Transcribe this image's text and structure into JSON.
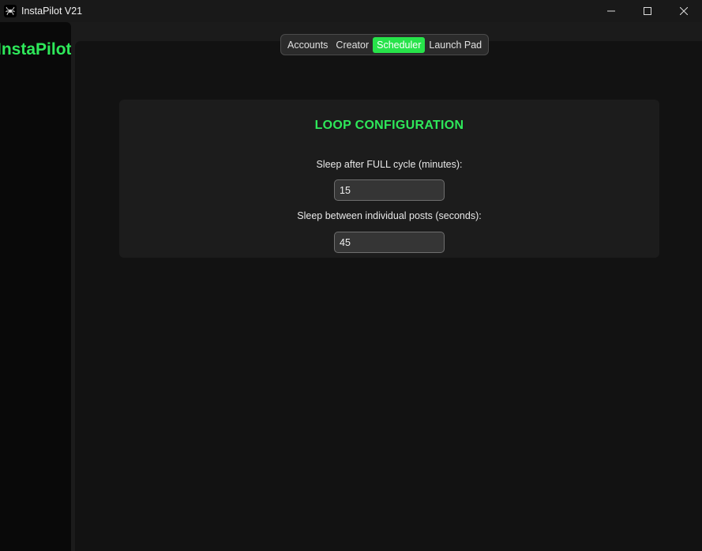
{
  "window": {
    "title": "InstaPilot V21",
    "icon": "spider-icon",
    "controls": [
      "minimize-icon",
      "maximize-icon",
      "close-icon"
    ]
  },
  "sidebar": {
    "title": "InstaPilot",
    "title_color": "#2ee85a"
  },
  "tabs": {
    "items": [
      {
        "label": "Accounts",
        "active": false
      },
      {
        "label": "Creator",
        "active": false
      },
      {
        "label": "Scheduler",
        "active": true
      },
      {
        "label": "Launch Pad",
        "active": false
      }
    ],
    "active_color": "#27e34a"
  },
  "loop_config": {
    "title": "LOOP CONFIGURATION",
    "full_cycle_label": "Sleep after FULL cycle (minutes):",
    "full_cycle_value": "15",
    "between_posts_label": "Sleep between individual posts (seconds):",
    "between_posts_value": "45"
  },
  "colors": {
    "accent": "#2ee85a",
    "background": "#121212",
    "card": "#1c1c1c"
  }
}
